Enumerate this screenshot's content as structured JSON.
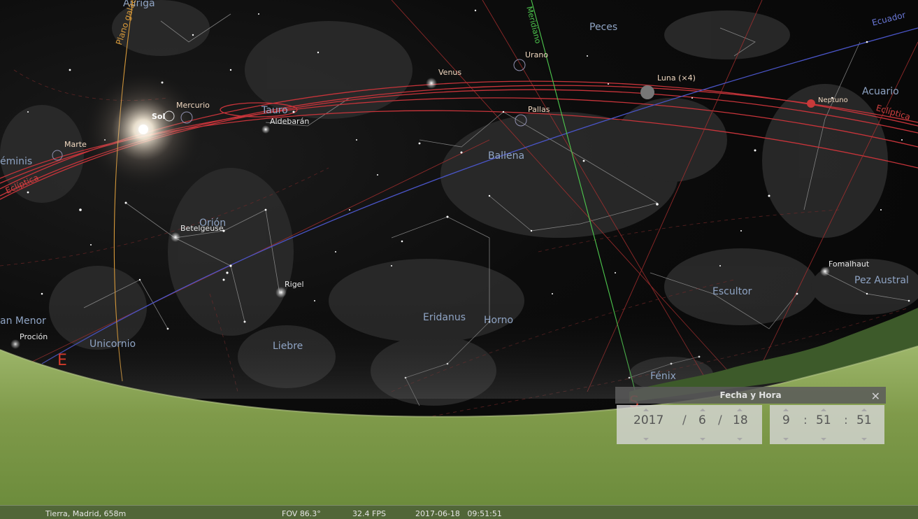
{
  "sky": {
    "constellations": {
      "auriga": "Auriga",
      "pisces": "Peces",
      "aquarius": "Acuario",
      "taurus": "Tauro",
      "gemini": "éminis",
      "cetus": "Ballena",
      "orion": "Orión",
      "canis_minor": "an Menor",
      "monoceros": "Unicornio",
      "lepus": "Liebre",
      "eridanus": "Eridanus",
      "fornax": "Horno",
      "sculptor": "Escultor",
      "piscis_austrinus": "Pez Austral",
      "phoenix": "Fénix"
    },
    "stars": {
      "aldebaran": "Aldebarán",
      "betelgeuse": "Betelgeuse",
      "rigel": "Rigel",
      "procyon": "Proción",
      "fomalhaut": "Fomalhaut"
    },
    "planets": {
      "sun": "Sol",
      "mercury": "Mercurio",
      "venus": "Venus",
      "mars": "Marte",
      "uranus": "Urano",
      "pallas": "Pallas",
      "moon": "Luna (×4)",
      "neptune": "Neptuno"
    },
    "lines": {
      "galactic_plane": "Plano galáctico",
      "meridian": "Meridiano",
      "equator": "Ecuador",
      "ecliptic_left": "Eclíptica",
      "ecliptic_right": "Eclíptica"
    },
    "cardinals": {
      "east": "E",
      "south": "S"
    }
  },
  "datetime_dialog": {
    "title": "Fecha y Hora",
    "close": "✕",
    "year": "2017",
    "month": "6",
    "day": "18",
    "hour": "9",
    "minute": "51",
    "second": "51",
    "date_sep": "/",
    "time_sep": ":"
  },
  "statusbar": {
    "location": "Tierra, Madrid, 658m",
    "fov": "FOV 86.3°",
    "fps": "32.4 FPS",
    "datetime": "2017-06-18   09:51:51"
  },
  "colors": {
    "ecliptic": "#c8343a",
    "equator": "#4a55c8",
    "meridian": "#4ec84e",
    "galactic": "#d89a3a",
    "constellation_label": "#8fa4c4",
    "ground": "#7a9a45"
  }
}
